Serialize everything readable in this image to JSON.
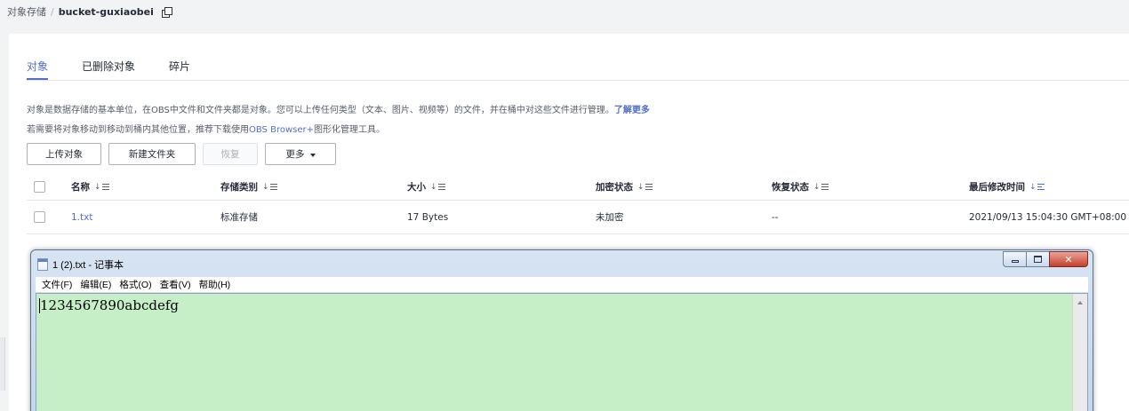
{
  "breadcrumb": {
    "root": "对象存储",
    "separator": "/",
    "current": "bucket-guxiaobei"
  },
  "tabs": [
    {
      "label": "对象",
      "active": true
    },
    {
      "label": "已删除对象",
      "active": false
    },
    {
      "label": "碎片",
      "active": false
    }
  ],
  "description": {
    "line1": "对象是数据存储的基本单位，在OBS中文件和文件夹都是对象。您可以上传任何类型（文本、图片、视频等）的文件，并在桶中对这些文件进行管理。",
    "line1_link": "了解更多",
    "line2_prefix": "若需要将对象移动到移动到桶内其他位置，推荐下载使用",
    "line2_link": "OBS Browser+",
    "line2_suffix": "图形化管理工具。"
  },
  "toolbar": {
    "upload": "上传对象",
    "new_folder": "新建文件夹",
    "restore": "恢复",
    "more": "更多"
  },
  "table": {
    "columns": [
      "名称",
      "存储类别",
      "大小",
      "加密状态",
      "恢复状态",
      "最后修改时间"
    ],
    "rows": [
      {
        "name": "1.txt",
        "storage_class": "标准存储",
        "size": "17 Bytes",
        "encryption": "未加密",
        "restore": "--",
        "modified": "2021/09/13 15:04:30 GMT+08:00"
      }
    ]
  },
  "notepad": {
    "title": "1 (2).txt - 记事本",
    "menus": [
      "文件(F)",
      "编辑(E)",
      "格式(O)",
      "查看(V)",
      "帮助(H)"
    ],
    "content": "1234567890abcdefg",
    "editor_bg": "#c6efc8"
  },
  "colors": {
    "accent": "#526ecc",
    "text": "#252b3a"
  }
}
